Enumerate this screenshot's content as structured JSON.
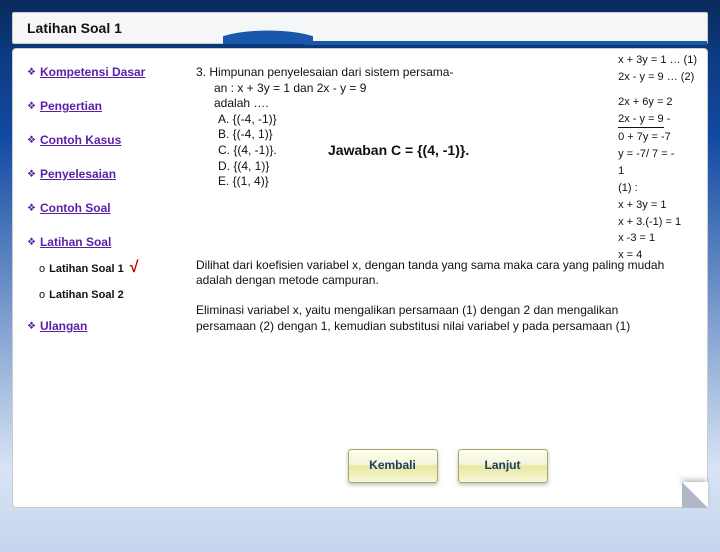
{
  "header": {
    "title": "Latihan Soal 1"
  },
  "sidebar": {
    "items": [
      {
        "label": "Kompetensi Dasar"
      },
      {
        "label": "Pengertian"
      },
      {
        "label": "Contoh Kasus"
      },
      {
        "label": "Penyelesaian"
      },
      {
        "label": "Contoh Soal"
      },
      {
        "label": "Latihan Soal"
      },
      {
        "label": "Ulangan"
      }
    ],
    "sub": [
      {
        "label": "Latihan Soal 1",
        "mark": "√"
      },
      {
        "label": "Latihan Soal 2"
      }
    ]
  },
  "content": {
    "q_line1": "3. Himpunan penyelesaian dari sistem persama-",
    "q_line2": "an :   x + 3y = 1 dan 2x - y = 9",
    "q_line3": "adalah ….",
    "optA": "A. {(-4, -1)}",
    "optB": "B. {(-4, 1)}",
    "optC": "C. {(4, -1)}.",
    "optD": "D. {(4, 1)}",
    "optE": "E. {(1, 4)}",
    "answer": "Jawaban C = {(4, -1)}.",
    "explain1": "Dilihat dari koefisien variabel x, dengan tanda yang sama maka cara yang paling mudah adalah dengan metode campuran.",
    "explain2": "Eliminasi variabel x, yaitu mengalikan persamaan (1) dengan 2 dan mengalikan persamaan (2) dengan 1, kemudian substitusi nilai variabel y pada persamaan (1)"
  },
  "work": {
    "r1": "x + 3y = 1 … (1)",
    "r2": "2x  - y = 9 … (2)",
    "r3": "2x + 6y = 2",
    "r4a": "2x  - y  = 9",
    "r4b": "-",
    "r5": "0 +  7y  = -7",
    "r6": "       y  = -7/ 7 = -",
    "r7": "1",
    "r8": "(1) :",
    "r9": "   x  + 3y = 1",
    "r10": "x + 3.(-1) = 1",
    "r11": "         x -3 = 1",
    "r12": "            x = 4"
  },
  "buttons": {
    "back": "Kembali",
    "next": "Lanjut"
  }
}
